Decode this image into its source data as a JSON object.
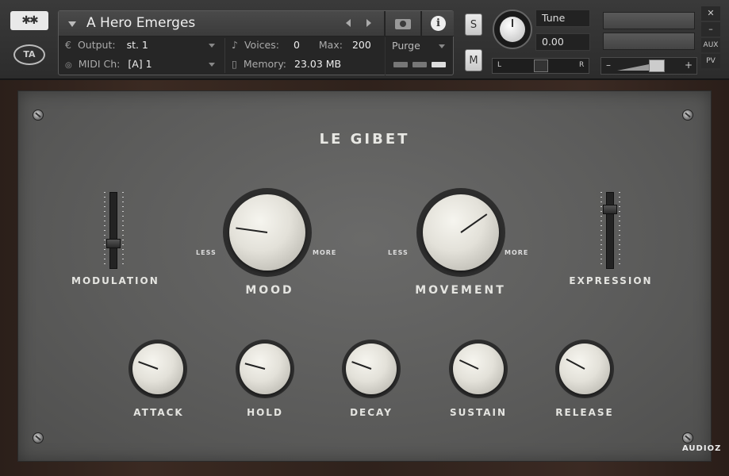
{
  "header": {
    "logo_snow_text": "✱✱",
    "logo_ta_text": "TA",
    "instrument_name": "A Hero Emerges",
    "output_label": "Output:",
    "output_value": "st. 1",
    "voices_label": "Voices:",
    "voices_value": "0",
    "max_label": "Max:",
    "max_value": "200",
    "purge_label": "Purge",
    "midi_label": "MIDI Ch:",
    "midi_value": "[A]  1",
    "memory_label": "Memory:",
    "memory_value": "23.03 MB",
    "solo_label": "S",
    "mute_label": "M",
    "tune_label": "Tune",
    "tune_value": "0.00",
    "pan_left": "L",
    "pan_right": "R",
    "vol_minus": "–",
    "vol_plus": "+",
    "close_label": "✕",
    "minimize_label": "–",
    "aux_label": "AUX",
    "pv_label": "PV"
  },
  "instrument": {
    "title": "LE GIBET",
    "modulation_label": "MODULATION",
    "expression_label": "EXPRESSION",
    "mood_label": "MOOD",
    "movement_label": "MOVEMENT",
    "less_label": "LESS",
    "more_label": "MORE",
    "envelope": {
      "attack_label": "ATTACK",
      "hold_label": "HOLD",
      "decay_label": "DECAY",
      "sustain_label": "SUSTAIN",
      "release_label": "RELEASE"
    }
  },
  "watermark": "AUDIOZ"
}
